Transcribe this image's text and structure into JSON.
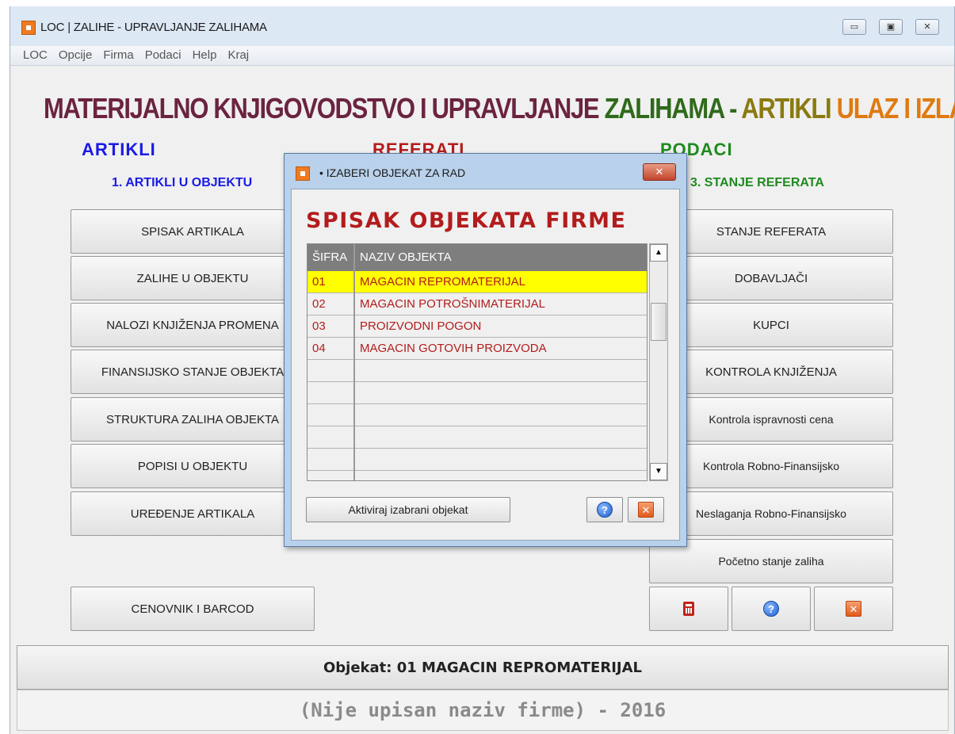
{
  "window": {
    "title": "LOC | ZALIHE - UPRAVLJANJE ZALIHAMA",
    "controls": {
      "minimize": "▭",
      "maximize": "▣",
      "close": "✕"
    }
  },
  "menu": [
    "LOC",
    "Opcije",
    "Firma",
    "Podaci",
    "Help",
    "Kraj"
  ],
  "headline": {
    "part1": "MATERIJALNO KNJIGOVODSTVO I UPRAVLJANJE ZALIHAMA - ",
    "part2": "ARTIKLI ",
    "part3": "ULAZ I IZLAZ",
    "colors": {
      "part1a": "#6b2340",
      "part1b": "#2e6a1a",
      "part2": "#8a7a10",
      "part3": "#e07a10"
    }
  },
  "sections": {
    "artikli": {
      "title": "ARTIKLI",
      "color": "#1a1ae6",
      "subtitle": "1. ARTIKLI U OBJEKTU"
    },
    "referati": {
      "title": "REFERATI",
      "color": "#b31c1c"
    },
    "podaci": {
      "title": "PODACI",
      "color": "#1e8a1e",
      "subtitle": "3. STANJE REFERATA"
    }
  },
  "left_buttons": [
    "SPISAK ARTIKALA",
    "ZALIHE U OBJEKTU",
    "NALOZI KNJIŽENJA PROMENA",
    "FINANSIJSKO STANJE OBJEKTA",
    "STRUKTURA ZALIHA OBJEKTA",
    "POPISI U OBJEKTU",
    "UREĐENJE ARTIKALA"
  ],
  "cenovnik_button": "CENOVNIK I BARCOD",
  "right_buttons": [
    "STANJE REFERATA",
    "DOBAVLJAČI",
    "KUPCI",
    "KONTROLA KNJIŽENJA",
    "Kontrola ispravnosti cena",
    "Kontrola Robno-Finansijsko",
    "Neslaganja Robno-Finansijsko",
    "Početno stanje zaliha"
  ],
  "bottom_icons": [
    "calculator-icon",
    "help-icon",
    "close-icon"
  ],
  "status": "Objekat: 01 MAGACIN REPROMATERIJAL",
  "footer": "(Nije upisan naziv firme) - 2016",
  "dialog": {
    "title": "• IZABERI OBJEKAT ZA RAD",
    "heading": "SPISAK OBJEKATA FIRME",
    "columns": [
      "ŠIFRA",
      "NAZIV OBJEKTA"
    ],
    "rows": [
      {
        "code": "01",
        "name": "MAGACIN REPROMATERIJAL",
        "selected": true
      },
      {
        "code": "02",
        "name": "MAGACIN POTROŠNIMATERIJAL",
        "selected": false
      },
      {
        "code": "03",
        "name": "PROIZVODNI POGON",
        "selected": false
      },
      {
        "code": "04",
        "name": "MAGACIN GOTOVIH PROIZVODA",
        "selected": false
      }
    ],
    "activate_button": "Aktiviraj izabrani objekat",
    "help_icon": "help-icon",
    "close_icon": "close-icon"
  }
}
